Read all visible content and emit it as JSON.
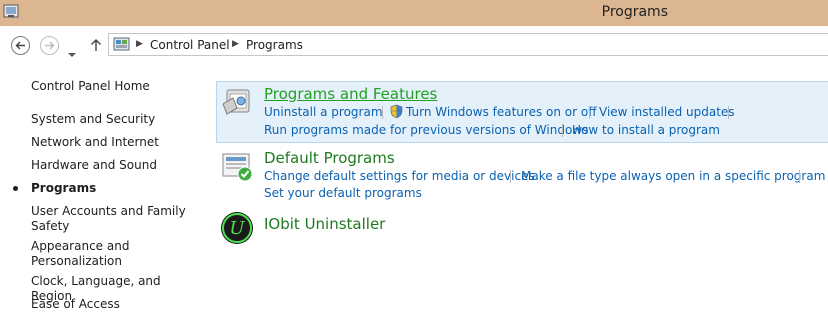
{
  "window": {
    "title": "Programs"
  },
  "breadcrumb": {
    "root": "Control Panel",
    "current": "Programs"
  },
  "sidebar": {
    "home": "Control Panel Home",
    "items": [
      {
        "label": "System and Security"
      },
      {
        "label": "Network and Internet"
      },
      {
        "label": "Hardware and Sound"
      },
      {
        "label": "Programs",
        "active": true
      },
      {
        "label": "User Accounts and Family Safety"
      },
      {
        "label": "Appearance and Personalization"
      },
      {
        "label": "Clock, Language, and Region"
      },
      {
        "label": "Ease of Access"
      }
    ]
  },
  "categories": [
    {
      "title": "Programs and Features",
      "icon": "programs-and-features-icon",
      "links": [
        "Uninstall a program",
        "Turn Windows features on or off",
        "View installed updates",
        "Run programs made for previous versions of Windows",
        "How to install a program"
      ]
    },
    {
      "title": "Default Programs",
      "icon": "default-programs-icon",
      "links": [
        "Change default settings for media or devices",
        "Make a file type always open in a specific program",
        "Set your default programs"
      ]
    },
    {
      "title": "IObit Uninstaller",
      "icon": "iobit-uninstaller-icon",
      "links": []
    }
  ],
  "colors": {
    "titlebar": "#dcb690",
    "link": "#0b61b0",
    "category_title": "#1e7a1e",
    "highlight": "#e4f1fb"
  }
}
